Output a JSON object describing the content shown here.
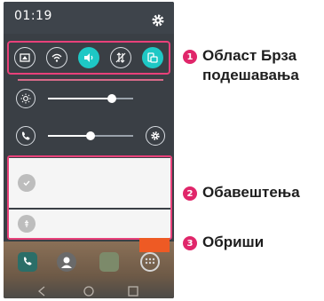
{
  "status_bar": {
    "time": "01:19",
    "settings_icon": "gear-icon"
  },
  "quick_settings": {
    "buttons": [
      {
        "name": "capture-icon",
        "state": "off"
      },
      {
        "name": "wifi-icon",
        "state": "off"
      },
      {
        "name": "sound-icon",
        "state": "on"
      },
      {
        "name": "data-off-icon",
        "state": "off"
      },
      {
        "name": "rotation-icon",
        "state": "on"
      }
    ]
  },
  "sliders": {
    "brightness": {
      "icon": "brightness-icon",
      "level": 0.75
    },
    "volume": {
      "icon": "volume-call-icon",
      "level": 0.5,
      "settings_icon": "gear-icon"
    }
  },
  "notifications": [
    {
      "icon": "check-icon"
    },
    {
      "icon": "usb-icon"
    }
  ],
  "callouts": [
    {
      "number": "1",
      "text_line1": "Област Брза",
      "text_line2": "подешавања"
    },
    {
      "number": "2",
      "text": "Обавештења"
    },
    {
      "number": "3",
      "text": "Обриши"
    }
  ],
  "colors": {
    "highlight": "#e8417a",
    "accent": "#1ec8c5",
    "badge": "#e0266a",
    "clear_button": "#ee5a24"
  }
}
